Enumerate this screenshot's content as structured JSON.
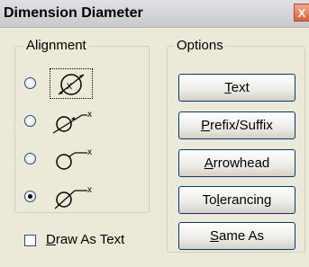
{
  "window": {
    "title": "Dimension Diameter",
    "close_glyph": "X"
  },
  "alignment": {
    "label": "Alignment",
    "options": [
      {
        "icon": "diameter-text-inside-icon",
        "selected": false,
        "focused": true
      },
      {
        "icon": "diameter-arrow-outside-icon",
        "selected": false
      },
      {
        "icon": "diameter-leader-outside-icon",
        "selected": false
      },
      {
        "icon": "diameter-text-outside-icon",
        "selected": true
      }
    ]
  },
  "options": {
    "label": "Options",
    "buttons": [
      {
        "pre": "",
        "mnemonic": "T",
        "post": "ext"
      },
      {
        "pre": "",
        "mnemonic": "P",
        "post": "refix/Suffix"
      },
      {
        "pre": "",
        "mnemonic": "A",
        "post": "rrowhead"
      },
      {
        "pre": "To",
        "mnemonic": "l",
        "post": "erancing"
      },
      {
        "pre": "",
        "mnemonic": "S",
        "post": "ame As"
      }
    ]
  },
  "draw_as_text": {
    "pre": "",
    "mnemonic": "D",
    "post": "raw As Text",
    "checked": false
  },
  "colors": {
    "dialog_bg": "#ece9d8",
    "button_border": "#003c74",
    "close_red": "#e0603c"
  }
}
